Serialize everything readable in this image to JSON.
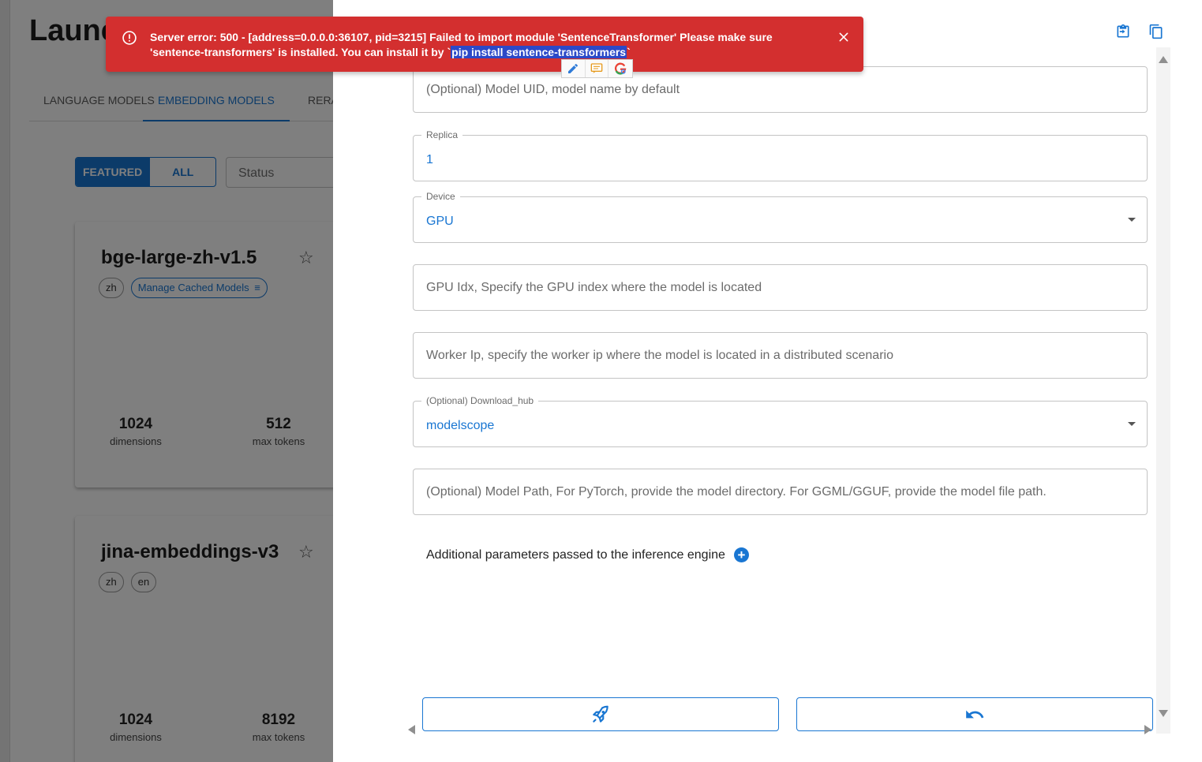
{
  "background": {
    "page_title": "Launc",
    "tabs": [
      {
        "label": "LANGUAGE MODELS",
        "active": false
      },
      {
        "label": "EMBEDDING MODELS",
        "active": true
      },
      {
        "label": "RERA",
        "active": false
      }
    ],
    "filter_toggle": {
      "featured": "FEATURED",
      "all": "ALL"
    },
    "status_select": {
      "placeholder": "Status"
    },
    "cards": [
      {
        "title": "bge-large-zh-v1.5",
        "chips": [
          "zh"
        ],
        "manage_cached": "Manage Cached Models",
        "stats": [
          {
            "value": "1024",
            "label": "dimensions"
          },
          {
            "value": "512",
            "label": "max tokens"
          }
        ]
      },
      {
        "title": "jina-embeddings-v3",
        "chips": [
          "zh",
          "en"
        ],
        "stats": [
          {
            "value": "1024",
            "label": "dimensions"
          },
          {
            "value": "8192",
            "label": "max tokens"
          }
        ]
      }
    ]
  },
  "drawer": {
    "fields": {
      "model_uid": {
        "placeholder": "(Optional) Model UID, model name by default"
      },
      "replica": {
        "label": "Replica",
        "value": "1"
      },
      "device": {
        "label": "Device",
        "value": "GPU"
      },
      "gpu_idx": {
        "placeholder": "GPU Idx, Specify the GPU index where the model is located"
      },
      "worker_ip": {
        "placeholder": "Worker Ip, specify the worker ip where the model is located in a distributed scenario"
      },
      "download_hub": {
        "label": "(Optional) Download_hub",
        "value": "modelscope"
      },
      "model_path": {
        "placeholder": "(Optional) Model Path, For PyTorch, provide the model directory. For GGML/GGUF, provide the model file path."
      }
    },
    "additional_params_label": "Additional parameters passed to the inference engine"
  },
  "toast": {
    "message_prefix": "Server error: 500 - [address=0.0.0.0:36107, pid=3215] Failed to import module 'SentenceTransformer' Please make sure 'sentence-transformers' is installed. You can install it by `",
    "selected_text": "pip install sentence-transformers",
    "message_suffix": "`"
  },
  "colors": {
    "accent": "#1976d2",
    "error": "#d32f2f",
    "selection": "#2b49c8"
  },
  "icons": [
    "error-icon",
    "close-icon",
    "copy-to-clipboard-icon",
    "duplicate-icon",
    "star-icon",
    "rocket-icon",
    "undo-icon",
    "plus-circle-icon",
    "pencil-icon",
    "comment-icon",
    "google-icon"
  ]
}
